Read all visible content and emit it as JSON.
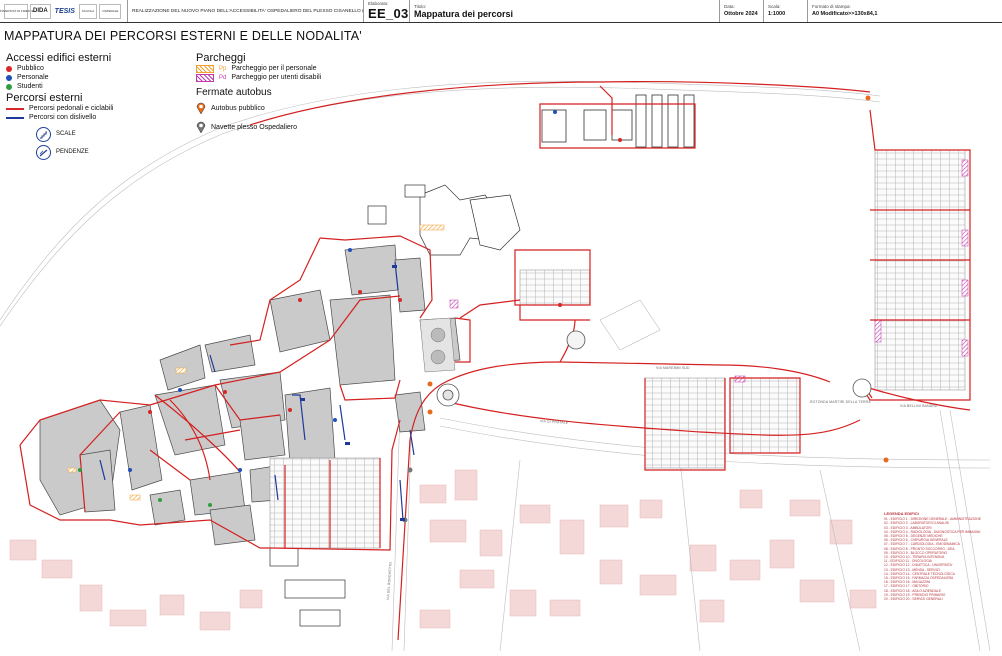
{
  "title_block": {
    "logos": [
      "UNIVERSITÀ DI FIRENZE",
      "DIDA",
      "TESIS",
      "SCUOLA",
      "OSPEDALE"
    ],
    "project_description": "REALIZZAZIONE DEL NUOVO PIANO DELL'ACCESSIBILITA' OSPEDALIERO DEL PLESSO CISANELLO (Pisa)",
    "drawing_label": "Elaborato:",
    "drawing_code": "EE_03",
    "title_label": "Titolo:",
    "drawing_title": "Mappatura dei percorsi",
    "date_label": "Data:",
    "date_value": "Ottobre 2024",
    "scale_label": "Scala:",
    "scale_value": "1:1000",
    "format_label": "Formato di stampa:",
    "format_value": "A0 Modificato>>130x84,1"
  },
  "map_title": "MAPPATURA DEI PERCORSI ESTERNI E DELLE NODALITA'",
  "legend": {
    "accessi": {
      "heading": "Accessi edifici esterni",
      "items": [
        {
          "label": "Pubblico",
          "color": "#d62828"
        },
        {
          "label": "Personale",
          "color": "#1f4fb8"
        },
        {
          "label": "Studenti",
          "color": "#2f9e3f"
        }
      ]
    },
    "percorsi": {
      "heading": "Percorsi esterni",
      "items": [
        {
          "label": "Percorsi pedonali e ciclabili",
          "color": "#d62828"
        },
        {
          "label": "Percorsi con dislivello",
          "color": "#1f3a9a"
        }
      ]
    },
    "dislivelli": [
      {
        "label": "SCALE",
        "icon": "stairs-icon"
      },
      {
        "label": "PENDENZE",
        "icon": "ramp-icon"
      }
    ],
    "parcheggi": {
      "heading": "Parcheggi",
      "items": [
        {
          "code": "Pp",
          "label": "Parcheggio per il personale",
          "color": "#f0a030"
        },
        {
          "code": "Pd",
          "label": "Parcheggio per utenti disabili",
          "color": "#c03ab0"
        }
      ]
    },
    "fermate": {
      "heading": "Fermate autobus",
      "items": [
        {
          "label": "Autobus pubblico",
          "icon": "public-bus-stop-icon",
          "color": "#e86a1c"
        },
        {
          "label": "Navette plesso Ospedaliero",
          "icon": "shuttle-stop-icon",
          "color": "#777777"
        }
      ]
    }
  },
  "colors": {
    "route_red": "#d42020",
    "route_blue": "#1f3a9a",
    "building_fill": "#c9c9c9",
    "building_dark": "#a9a9a9",
    "context_buildings": "#f2d4d4",
    "parking_grid": "#9a9a9a"
  },
  "notes": {
    "heading": "LEGENDA EDIFICI",
    "lines": [
      "01 - EDIFICIO 1 - DIREZIONE GENERALE - AMMINISTRAZIONE",
      "02 - EDIFICIO 2 - LABORATORI DI ANALISI",
      "03 - EDIFICIO 3 - AMBULATORI",
      "04 - EDIFICIO 4 - RADIOLOGIA - DIAGNOSTICA PER IMMAGINI",
      "05 - EDIFICIO 5 - DEGENZE MEDICHE",
      "06 - EDIFICIO 6 - CHIRURGIA GENERALE",
      "07 - EDIFICIO 7 - CARDIOLOGIA - EMODINAMICA",
      "08 - EDIFICIO 8 - PRONTO SOCCORSO - DEA",
      "09 - EDIFICIO 9 - BLOCCO OPERATORIO",
      "10 - EDIFICIO 10 - TERAPIA INTENSIVA",
      "11 - EDIFICIO 11 - ONCOLOGIA",
      "12 - EDIFICIO 12 - DIDATTICA - UNIVERSITA'",
      "13 - EDIFICIO 13 - MENSA - SERVIZI",
      "14 - EDIFICIO 14 - CENTRALE TECNOLOGICA",
      "15 - EDIFICIO 15 - FARMACIA OSPEDALIERA",
      "16 - EDIFICIO 16 - MAGAZZINI",
      "17 - EDIFICIO 17 - OBITORIO",
      "18 - EDIFICIO 18 - ASILO AZIENDALE",
      "19 - EDIFICIO 19 - PRESIDIO PRIMARIO",
      "20 - EDIFICIO 20 - SERVIZI GENERALI"
    ]
  },
  "streets": [
    "VIA MAREMMI SUD",
    "VIA DI PRATALE",
    "VIA BELLINI BANDINI",
    "VIA DEL BORGHETTO",
    "ROTONDA MARTIRI DELLA TERRA"
  ]
}
